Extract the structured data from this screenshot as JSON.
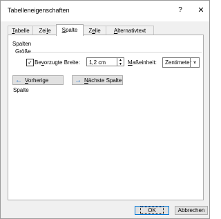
{
  "window": {
    "title": "Tabelleneigenschaften",
    "help_label": "?",
    "close_label": "✕"
  },
  "tabs": [
    {
      "label": "Tabelle",
      "accel": "T",
      "rest": "abelle",
      "active": false
    },
    {
      "label": "Zeile",
      "accel": "",
      "pre": "Zei",
      "accel2": "l",
      "post": "e",
      "active": false
    },
    {
      "label": "Spalte",
      "accel": "S",
      "rest": "palte",
      "active": true
    },
    {
      "label": "Zelle",
      "accel": "",
      "pre": "Z",
      "accel2": "e",
      "post": "lle",
      "active": false
    },
    {
      "label": "Alternativtext",
      "accel": "A",
      "rest": "lternativtext",
      "active": false
    }
  ],
  "panel": {
    "section_label": "Spalten",
    "group_label": "Größe",
    "preferred_width_label": "Bevorzugte Breite:",
    "preferred_width_checked": true,
    "preferred_width_value": "1,2 cm",
    "unit_label": "Maßeinheit:",
    "unit_value": "Zentimeter",
    "prev_column_label": "Vorherige Spalte",
    "next_column_label": "Nächste Spalte"
  },
  "footer": {
    "ok_label": "OK",
    "cancel_label": "Abbrechen"
  },
  "icons": {
    "prev": "arrow-left-icon",
    "next": "arrow-right-icon"
  },
  "colors": {
    "accent": "#0078d7",
    "arrow": "#1f6fc8"
  }
}
